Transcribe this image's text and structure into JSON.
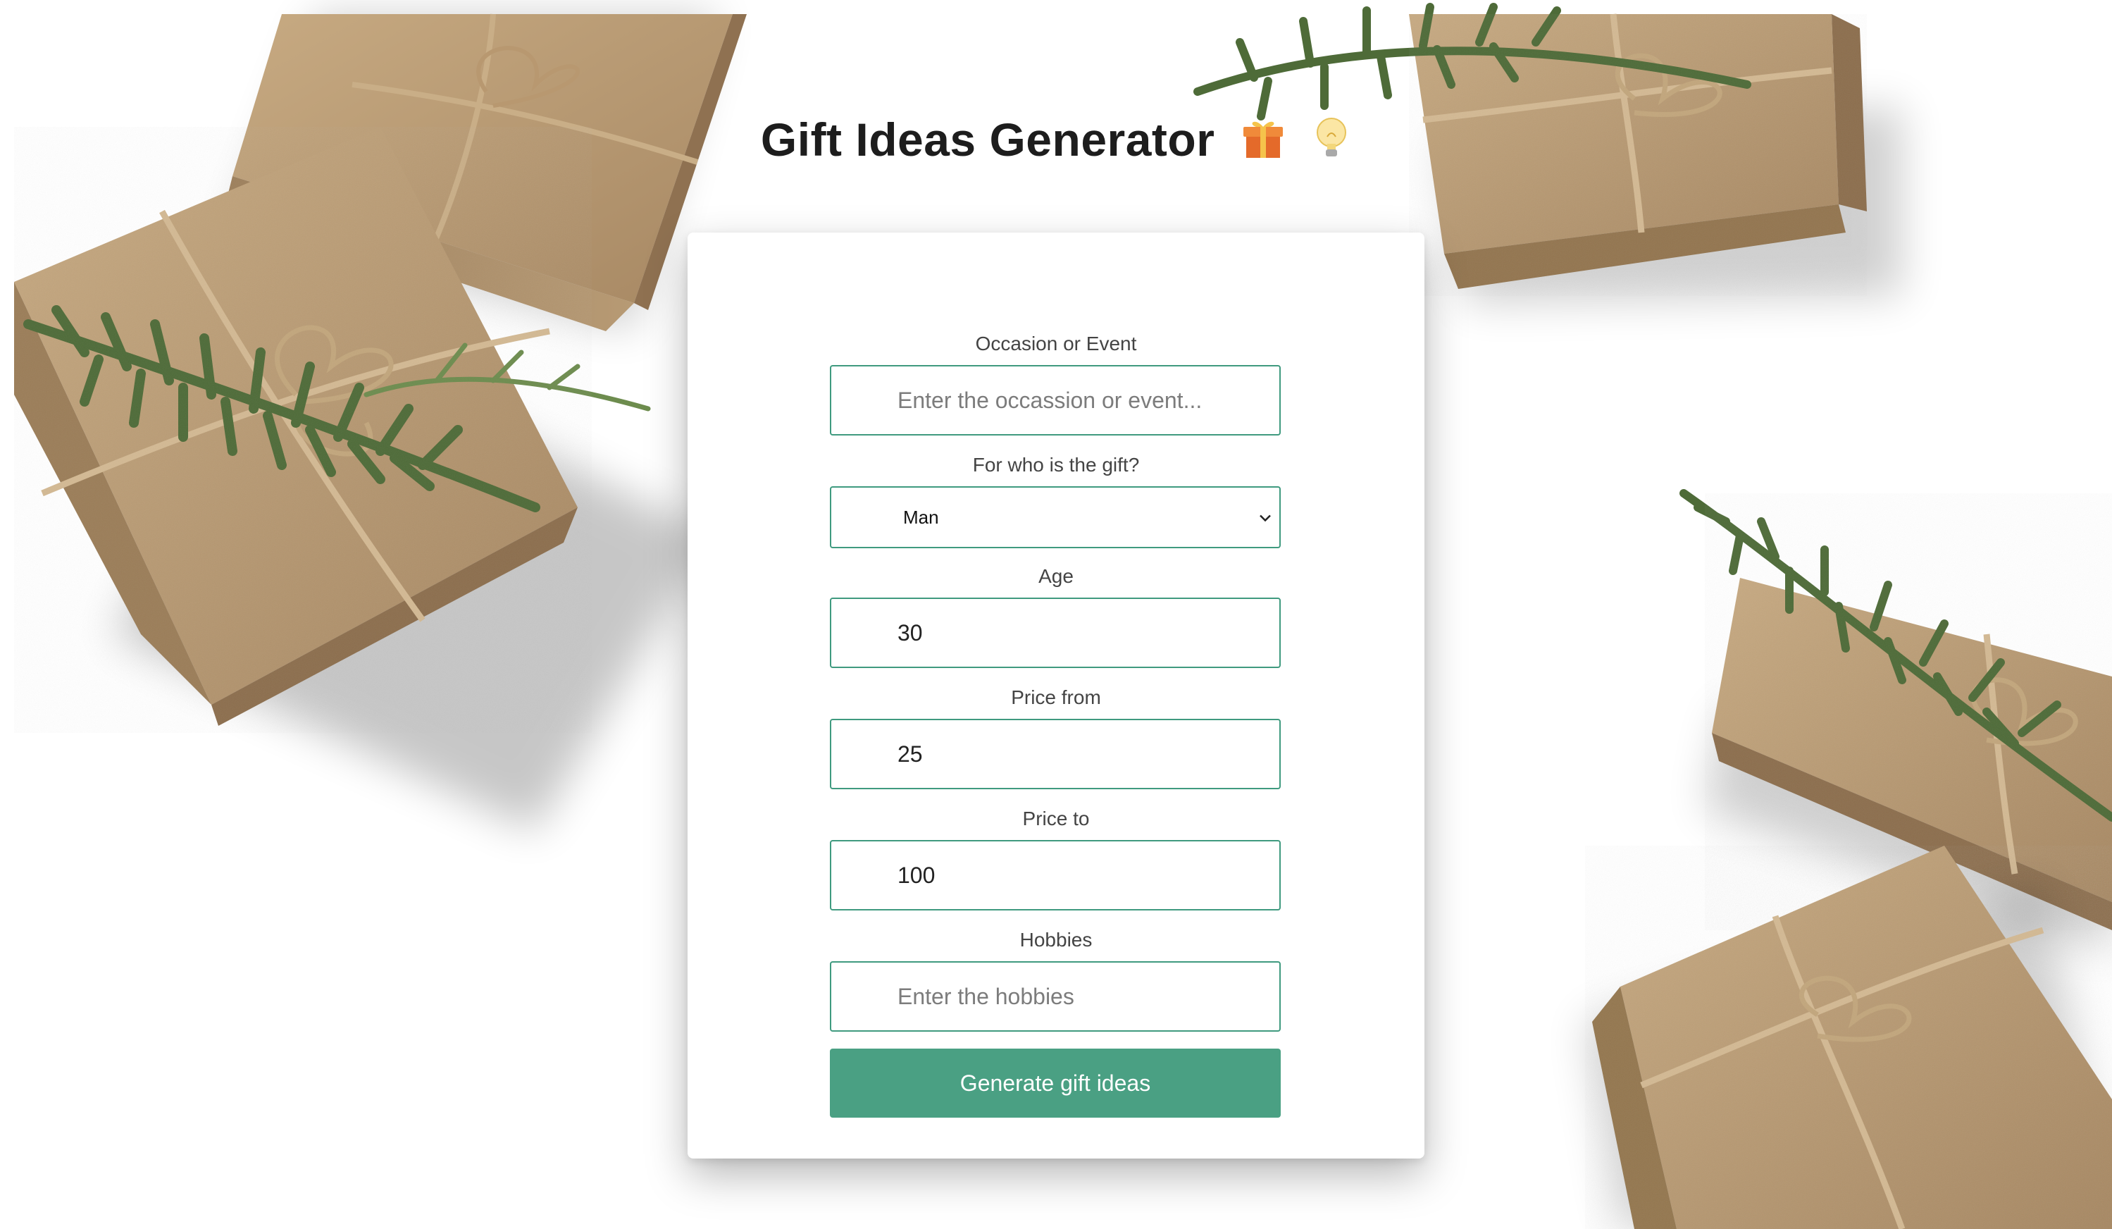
{
  "page": {
    "title": "Gift Ideas Generator",
    "title_emojis": [
      "gift-icon",
      "lightbulb-icon"
    ]
  },
  "form": {
    "occasion": {
      "label": "Occasion or Event",
      "value": "",
      "placeholder": "Enter the occassion or event..."
    },
    "recipient": {
      "label": "For who is the gift?",
      "selected": "Man",
      "icon": "chevron-down-icon"
    },
    "age": {
      "label": "Age",
      "value": "30"
    },
    "price_from": {
      "label": "Price from",
      "value": "25"
    },
    "price_to": {
      "label": "Price to",
      "value": "100"
    },
    "hobbies": {
      "label": "Hobbies",
      "value": "",
      "placeholder": "Enter the hobbies"
    },
    "submit_label": "Generate gift ideas"
  },
  "colors": {
    "accent": "#4aa083",
    "border": "#3f9a7f",
    "kraft": "#b99b74",
    "greenery": "#4e6b38",
    "twine": "#c2a67c"
  }
}
